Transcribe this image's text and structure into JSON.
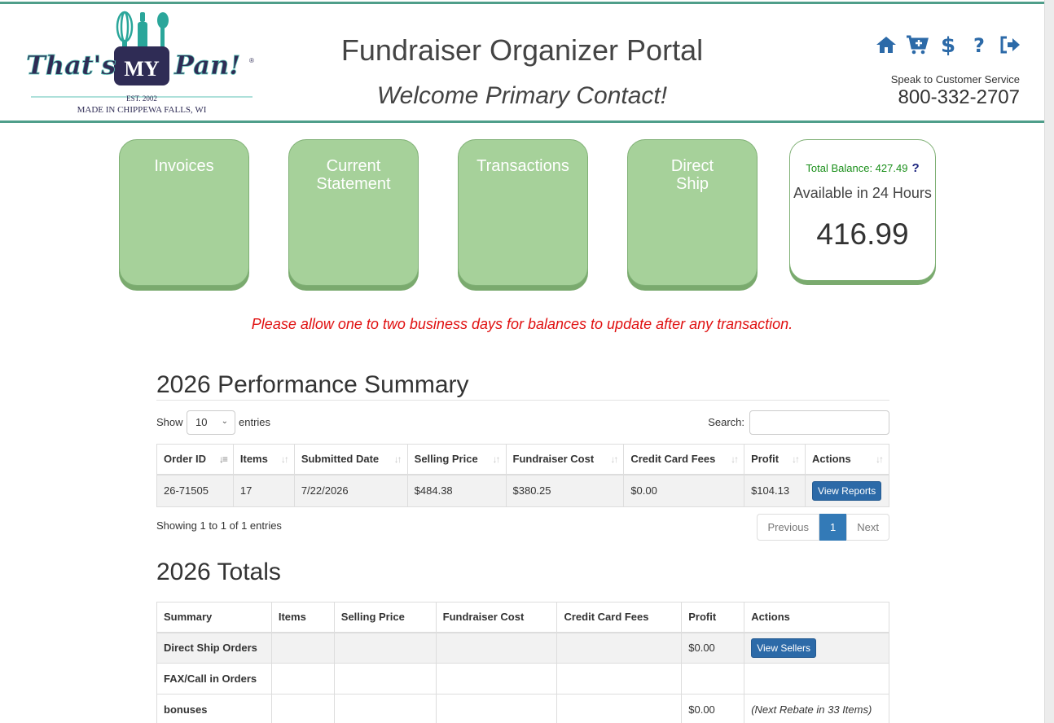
{
  "header": {
    "logo": {
      "brand": "That's MY Pan!",
      "est": "EST. 2002",
      "tagline": "MADE IN CHIPPEWA FALLS, WI"
    },
    "portal_title": "Fundraiser Organizer Portal",
    "welcome": "Welcome Primary Contact!",
    "icons": [
      "home-icon",
      "cart-plus-icon",
      "dollar-icon",
      "question-icon",
      "sign-out-icon"
    ],
    "speak_label": "Speak to Customer Service",
    "phone": "800-332-2707"
  },
  "tiles": [
    {
      "label": "Invoices"
    },
    {
      "label_line1": "Current",
      "label_line2": "Statement"
    },
    {
      "label": "Transactions"
    },
    {
      "label_line1": "Direct",
      "label_line2": "Ship"
    }
  ],
  "balance": {
    "total_label": "Total Balance: 427.49",
    "help": "?",
    "available_label": "Available in 24 Hours",
    "available_value": "416.99"
  },
  "notice": "Please allow one to two business days for balances to update after any transaction.",
  "performance": {
    "title": "2026 Performance Summary",
    "show_label": "Show",
    "show_value": "10",
    "entries_label": "entries",
    "search_label": "Search:",
    "columns": [
      "Order ID",
      "Items",
      "Submitted Date",
      "Selling Price",
      "Fundraiser Cost",
      "Credit Card Fees",
      "Profit",
      "Actions"
    ],
    "rows": [
      {
        "order_id": "26-71505",
        "items": "17",
        "date": "7/22/2026",
        "selling": "$484.38",
        "cost": "$380.25",
        "fees": "$0.00",
        "profit": "$104.13",
        "action": "View Reports"
      }
    ],
    "showing": "Showing 1 to 1 of 1 entries",
    "pager": {
      "prev": "Previous",
      "current": "1",
      "next": "Next"
    }
  },
  "totals": {
    "title": "2026 Totals",
    "columns": [
      "Summary",
      "Items",
      "Selling Price",
      "Fundraiser Cost",
      "Credit Card Fees",
      "Profit",
      "Actions"
    ],
    "rows": [
      {
        "summary": "Direct Ship Orders",
        "profit": "$0.00",
        "action": "View Sellers"
      },
      {
        "summary": "FAX/Call in Orders",
        "profit": "",
        "action": ""
      },
      {
        "summary": "bonuses",
        "profit": "$0.00",
        "note": "(Next Rebate in 33 Items)"
      }
    ]
  },
  "colors": {
    "teal": "#4f9e8a",
    "tile_green": "#a6d19a",
    "link_blue": "#2c6aa8",
    "notice_red": "#e01010"
  }
}
